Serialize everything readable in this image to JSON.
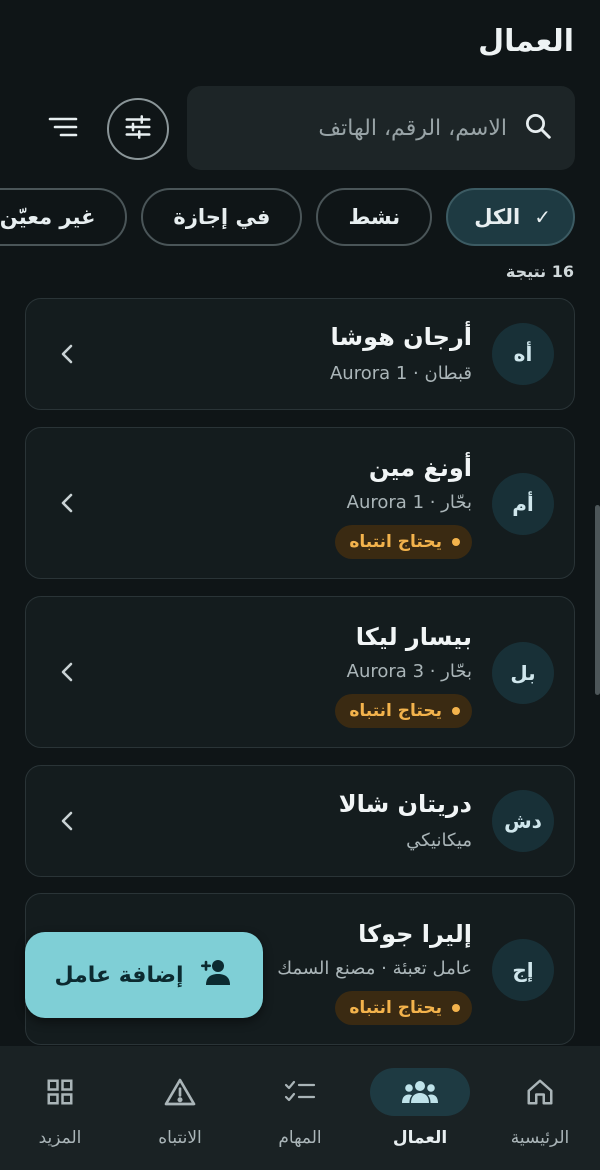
{
  "header": {
    "title": "العمال"
  },
  "search": {
    "placeholder": "الاسم، الرقم، الهاتف"
  },
  "filters": {
    "chips": [
      {
        "label": "الكل",
        "active": true
      },
      {
        "label": "نشط",
        "active": false
      },
      {
        "label": "في إجازة",
        "active": false
      },
      {
        "label": "غير معيّن",
        "active": false
      }
    ]
  },
  "results": {
    "count_text": "16 نتيجة"
  },
  "workers": [
    {
      "initials": "أه",
      "name": "أرجان هوشا",
      "subtitle": "قبطان · Aurora 1",
      "badge": ""
    },
    {
      "initials": "أم",
      "name": "أونغ مين",
      "subtitle": "بحّار · Aurora 1",
      "badge": "يحتاج انتباه"
    },
    {
      "initials": "بل",
      "name": "بيسار ليكا",
      "subtitle": "بحّار · Aurora 3",
      "badge": "يحتاج انتباه"
    },
    {
      "initials": "دش",
      "name": "دريتان شالا",
      "subtitle": "ميكانيكي",
      "badge": ""
    },
    {
      "initials": "إج",
      "name": "إليرا جوكا",
      "subtitle": "عامل تعبئة · مصنع السمك",
      "badge": "يحتاج انتباه"
    }
  ],
  "fab": {
    "label": "إضافة عامل"
  },
  "nav": {
    "items": [
      {
        "label": "الرئيسية",
        "icon": "home-icon",
        "active": false
      },
      {
        "label": "العمال",
        "icon": "people-icon",
        "active": true
      },
      {
        "label": "المهام",
        "icon": "checklist-icon",
        "active": false
      },
      {
        "label": "الانتباه",
        "icon": "warning-icon",
        "active": false
      },
      {
        "label": "المزيد",
        "icon": "grid-icon",
        "active": false
      }
    ]
  },
  "colors": {
    "accent": "#7fcfd6",
    "warning": "#f3b34c",
    "background": "#0f1517"
  }
}
